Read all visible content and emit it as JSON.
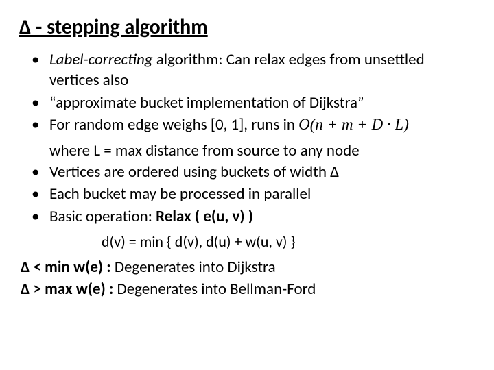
{
  "title": "Δ - stepping algorithm",
  "bullets": {
    "b1_pre": "Label-correcting",
    "b1_post": " algorithm: Can relax edges from unsettled vertices also",
    "b2": "“approximate bucket implementation of Dijkstra”",
    "b3_text": "For random edge weighs [0, 1],  runs in  ",
    "b3_formula": "O(n + m + D · L)",
    "b3_cont": "where L = max distance from source to any node",
    "b4": "Vertices are ordered using buckets of width Δ",
    "b5": "Each bucket may be processed in parallel",
    "b6_pre": "Basic operation: ",
    "b6_bold": "Relax ( e(u, v) )",
    "sub": "d(v) = min { d(v), d(u) + w(u, v) }"
  },
  "bottom": {
    "line1_bold": "Δ < min w(e) :",
    "line1_rest": " Degenerates into Dijkstra",
    "line2_bold": "Δ > max w(e) :",
    "line2_rest": " Degenerates into Bellman-Ford"
  }
}
